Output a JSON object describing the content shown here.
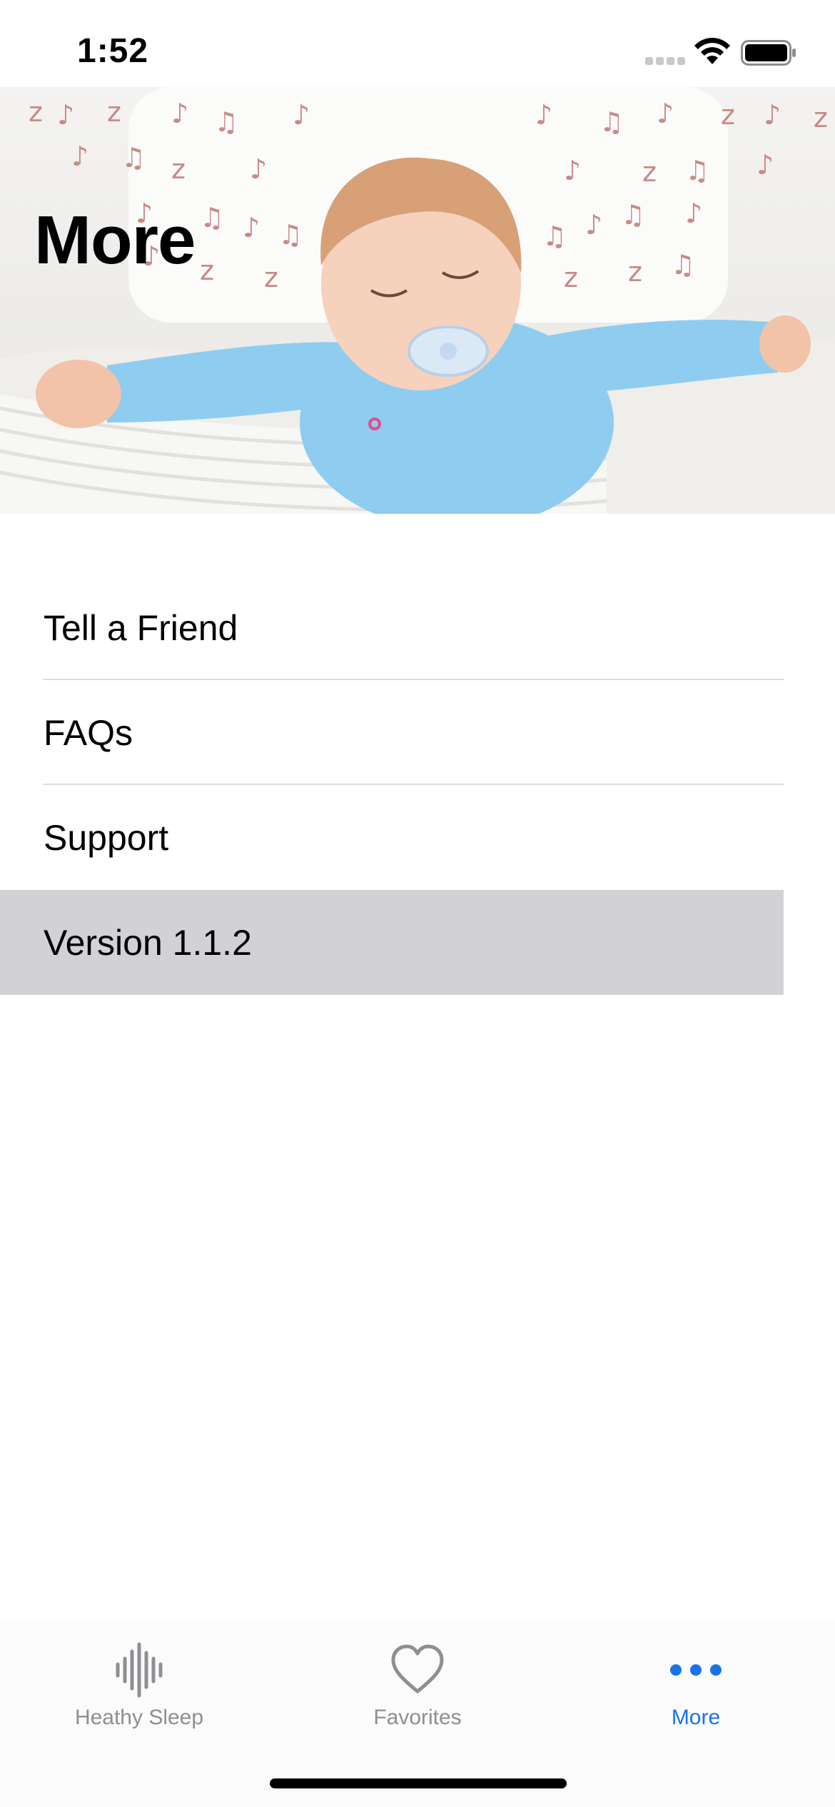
{
  "status_bar": {
    "time": "1:52"
  },
  "hero": {
    "title": "More"
  },
  "menu": {
    "items": [
      {
        "label": "Tell a Friend"
      },
      {
        "label": "FAQs"
      },
      {
        "label": "Support"
      },
      {
        "label": "Version 1.1.2"
      }
    ]
  },
  "tab_bar": {
    "tabs": [
      {
        "label": "Heathy Sleep",
        "icon": "waveform-icon"
      },
      {
        "label": "Favorites",
        "icon": "heart-icon"
      },
      {
        "label": "More",
        "icon": "more-dots-icon"
      }
    ],
    "active_color": "#1a73e8",
    "inactive_color": "#8e8e93"
  },
  "colors": {
    "selected_row": "#d1d1d6",
    "separator": "#dcdcdf"
  }
}
